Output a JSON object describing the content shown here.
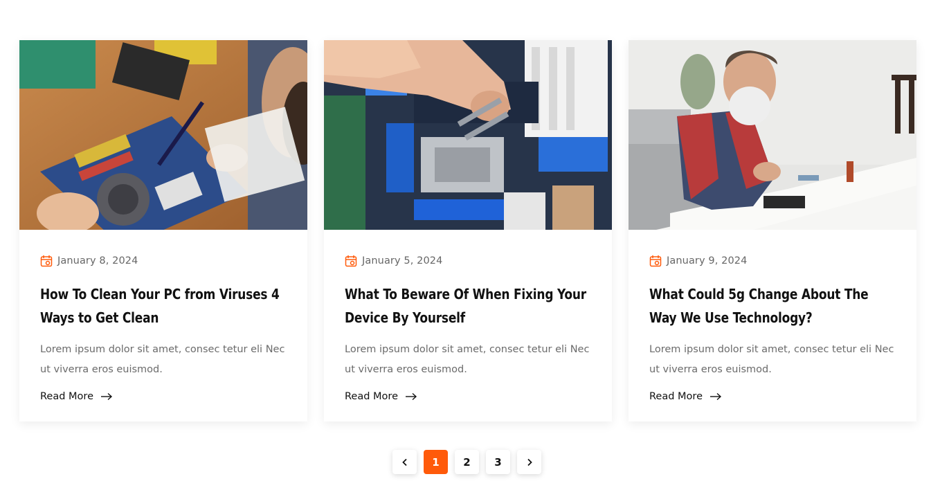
{
  "colors": {
    "accent": "#ff5a0a",
    "title": "#111111",
    "text": "#6b6b6b",
    "date": "#666666"
  },
  "posts": [
    {
      "image": "person-soldering-motherboard-on-wooden-desk",
      "date": "January 8, 2024",
      "title": "How To Clean Your PC from Viruses 4 Ways to Get Clean",
      "excerpt": "Lorem ipsum dolor sit amet, consec tetur eli Nec ut viverra eros euismod.",
      "read_more": "Read More"
    },
    {
      "image": "hand-installing-cpu-on-motherboard",
      "date": "January 5, 2024",
      "title": "What To Beware Of When Fixing Your Device By Yourself",
      "excerpt": "Lorem ipsum dolor sit amet, consec tetur eli Nec ut viverra eros euismod.",
      "read_more": "Read More"
    },
    {
      "image": "bearded-man-in-plaid-shirt-repairing-device",
      "date": "January 9, 2024",
      "title": "What Could 5g Change About The Way We Use Technology?",
      "excerpt": "Lorem ipsum dolor sit amet, consec tetur eli Nec ut viverra eros euismod.",
      "read_more": "Read More"
    }
  ],
  "pagination": {
    "prev_icon": "chevron-left-icon",
    "next_icon": "chevron-right-icon",
    "pages": [
      "1",
      "2",
      "3"
    ],
    "current": "1"
  }
}
